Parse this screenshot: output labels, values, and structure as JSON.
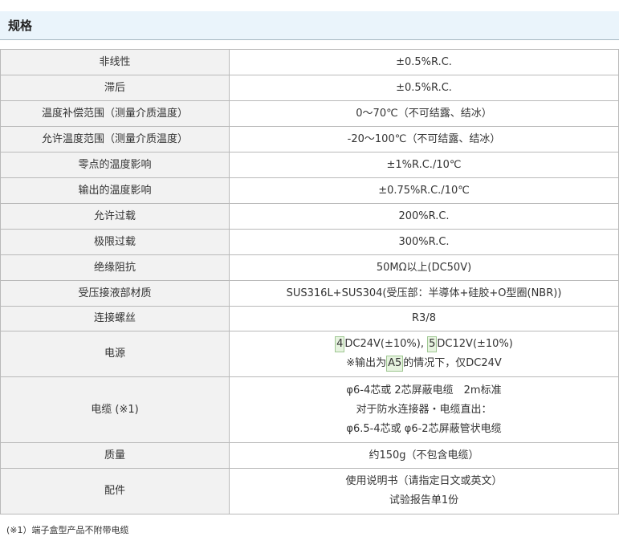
{
  "section_title": "规格",
  "rows": [
    {
      "label": "非线性",
      "value": "±0.5%R.C."
    },
    {
      "label": "滞后",
      "value": "±0.5%R.C."
    },
    {
      "label": "温度补偿范围（测量介质温度）",
      "value": "0～70℃（不可结露、结冰）"
    },
    {
      "label": "允许温度范围（测量介质温度）",
      "value": "-20～100℃（不可结露、结冰）"
    },
    {
      "label": "零点的温度影响",
      "value": "±1%R.C./10℃"
    },
    {
      "label": "输出的温度影响",
      "value": "±0.75%R.C./10℃"
    },
    {
      "label": "允许过载",
      "value": "200%R.C."
    },
    {
      "label": "极限过载",
      "value": "300%R.C."
    },
    {
      "label": "绝缘阻抗",
      "value": "50MΩ以上(DC50V)"
    },
    {
      "label": "受压接液部材质",
      "value": "SUS316L+SUS304(受压部：半導体+硅胶+O型圈(NBR))"
    },
    {
      "label": "连接螺丝",
      "value": "R3/8"
    }
  ],
  "power": {
    "label": "电源",
    "code1": "4",
    "text1": "DC24V(±10%),",
    "code2": "5",
    "text2": "DC12V(±10%)",
    "line2_prefix": "※输出为",
    "code3": "A5",
    "line2_suffix": "的情况下，仅DC24V"
  },
  "cable": {
    "label": "电缆 (※1)",
    "lines": [
      "φ6-4芯或 2芯屏蔽电缆　2m标准",
      "对于防水连接器・电缆直出：",
      "φ6.5-4芯或 φ6-2芯屏蔽管状电缆"
    ]
  },
  "weight": {
    "label": "质量",
    "value": "约150g（不包含电缆）"
  },
  "accessories": {
    "label": "配件",
    "lines": [
      "使用说明书（请指定日文或英文）",
      "试验报告单1份"
    ]
  },
  "footnote": "(※1）端子盒型产品不附带电缆"
}
